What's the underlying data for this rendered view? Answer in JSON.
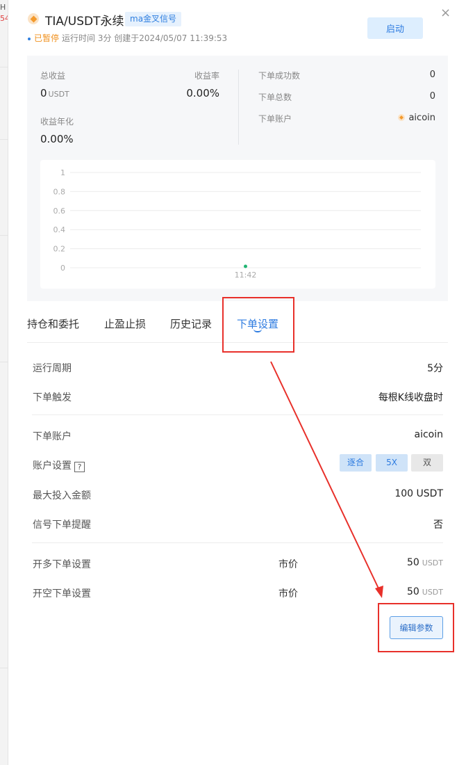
{
  "edge": {
    "line1": "H",
    "line2": "54"
  },
  "header": {
    "title": "TIA/USDT永续",
    "tag": "ma金叉信号",
    "status": "已暂停",
    "meta": "运行时间 3分 创建于2024/05/07 11:39:53",
    "start_label": "启动",
    "close_symbol": "×"
  },
  "stats": {
    "total_profit_label": "总收益",
    "total_profit_value": "0",
    "total_profit_unit": "USDT",
    "profit_rate_label": "收益率",
    "profit_rate_value": "0.00%",
    "annualized_label": "收益年化",
    "annualized_value": "0.00%",
    "orders_success_label": "下单成功数",
    "orders_success_value": "0",
    "orders_total_label": "下单总数",
    "orders_total_value": "0",
    "account_label": "下单账户",
    "account_value": "aicoin"
  },
  "chart_data": {
    "type": "line",
    "yticks": [
      "1",
      "0.8",
      "0.6",
      "0.4",
      "0.2",
      "0"
    ],
    "ylim": [
      0,
      1
    ],
    "x": [
      "11:42"
    ],
    "values": [
      0
    ],
    "point_color": "#21b573"
  },
  "tabs": [
    {
      "label": "持仓和委托"
    },
    {
      "label": "止盈止损"
    },
    {
      "label": "历史记录"
    },
    {
      "label": "下单设置"
    }
  ],
  "settings": {
    "cycle_label": "运行周期",
    "cycle_value": "5分",
    "trigger_label": "下单触发",
    "trigger_value": "每根K线收盘时",
    "account_label": "下单账户",
    "account_value": "aicoin",
    "account_settings_label": "账户设置",
    "help_symbol": "?",
    "chips": [
      "逐合",
      "5X",
      "双"
    ],
    "max_invest_label": "最大投入金额",
    "max_invest_value": "100 USDT",
    "signal_alert_label": "信号下单提醒",
    "signal_alert_value": "否",
    "long_label": "开多下单设置",
    "long_type": "市价",
    "long_amount": "50",
    "long_unit": "USDT",
    "short_label": "开空下单设置",
    "short_type": "市价",
    "short_amount": "50",
    "short_unit": "USDT",
    "edit_label": "编辑参数"
  },
  "colors": {
    "accent": "#2d7be0",
    "highlight": "#e8302a",
    "paused": "#f0911e"
  }
}
